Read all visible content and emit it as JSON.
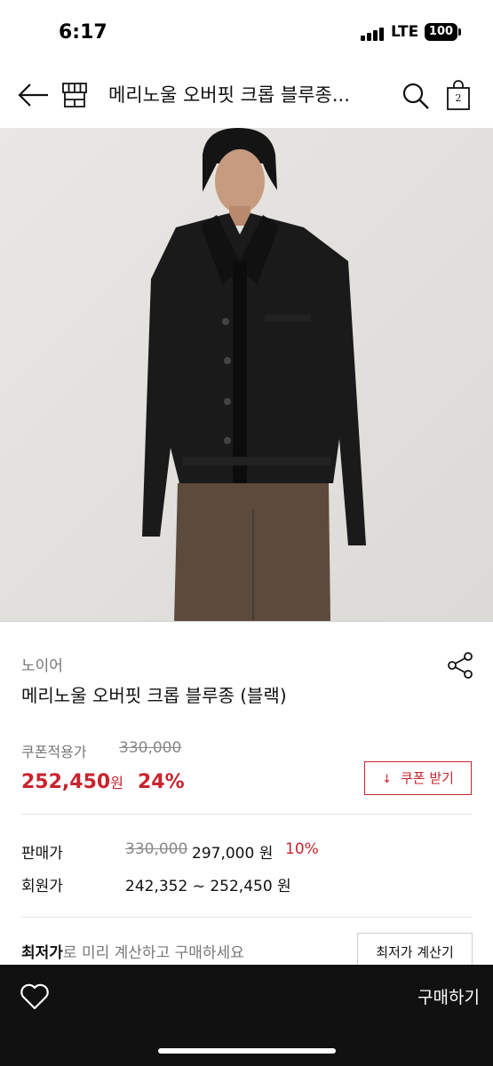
{
  "status": {
    "time": "6:17",
    "network": "LTE",
    "battery": "100"
  },
  "header": {
    "title": "메리노울 오버핏 크롭 블루종...",
    "cart_count": "2"
  },
  "product": {
    "brand": "노이어",
    "name": "메리노울 오버핏 크롭 블루종 (블랙)"
  },
  "coupon": {
    "label": "쿠폰적용가",
    "original_price": "330,000",
    "price": "252,450",
    "currency": "원",
    "rate": "24%",
    "button_label": "쿠폰 받기",
    "button_icon": "↓"
  },
  "sale": {
    "label": "판매가",
    "original_price": "330,000",
    "price": "297,000 원",
    "rate": "10%"
  },
  "member": {
    "label": "회원가",
    "price": "242,352 ~ 252,450 원"
  },
  "lowest": {
    "strong": "최저가",
    "text": "로 미리 계산하고 구매하세요",
    "button_label": "최저가 계산기"
  },
  "bottom": {
    "buy_label": "구매하기"
  },
  "icons": {
    "back": "arrow-left-icon",
    "store": "store-icon",
    "search": "search-icon",
    "cart": "shopping-bag-icon",
    "share": "share-icon",
    "wishlist": "heart-icon"
  },
  "colors": {
    "accent": "#c8242e",
    "bottom_bar": "#111111"
  }
}
